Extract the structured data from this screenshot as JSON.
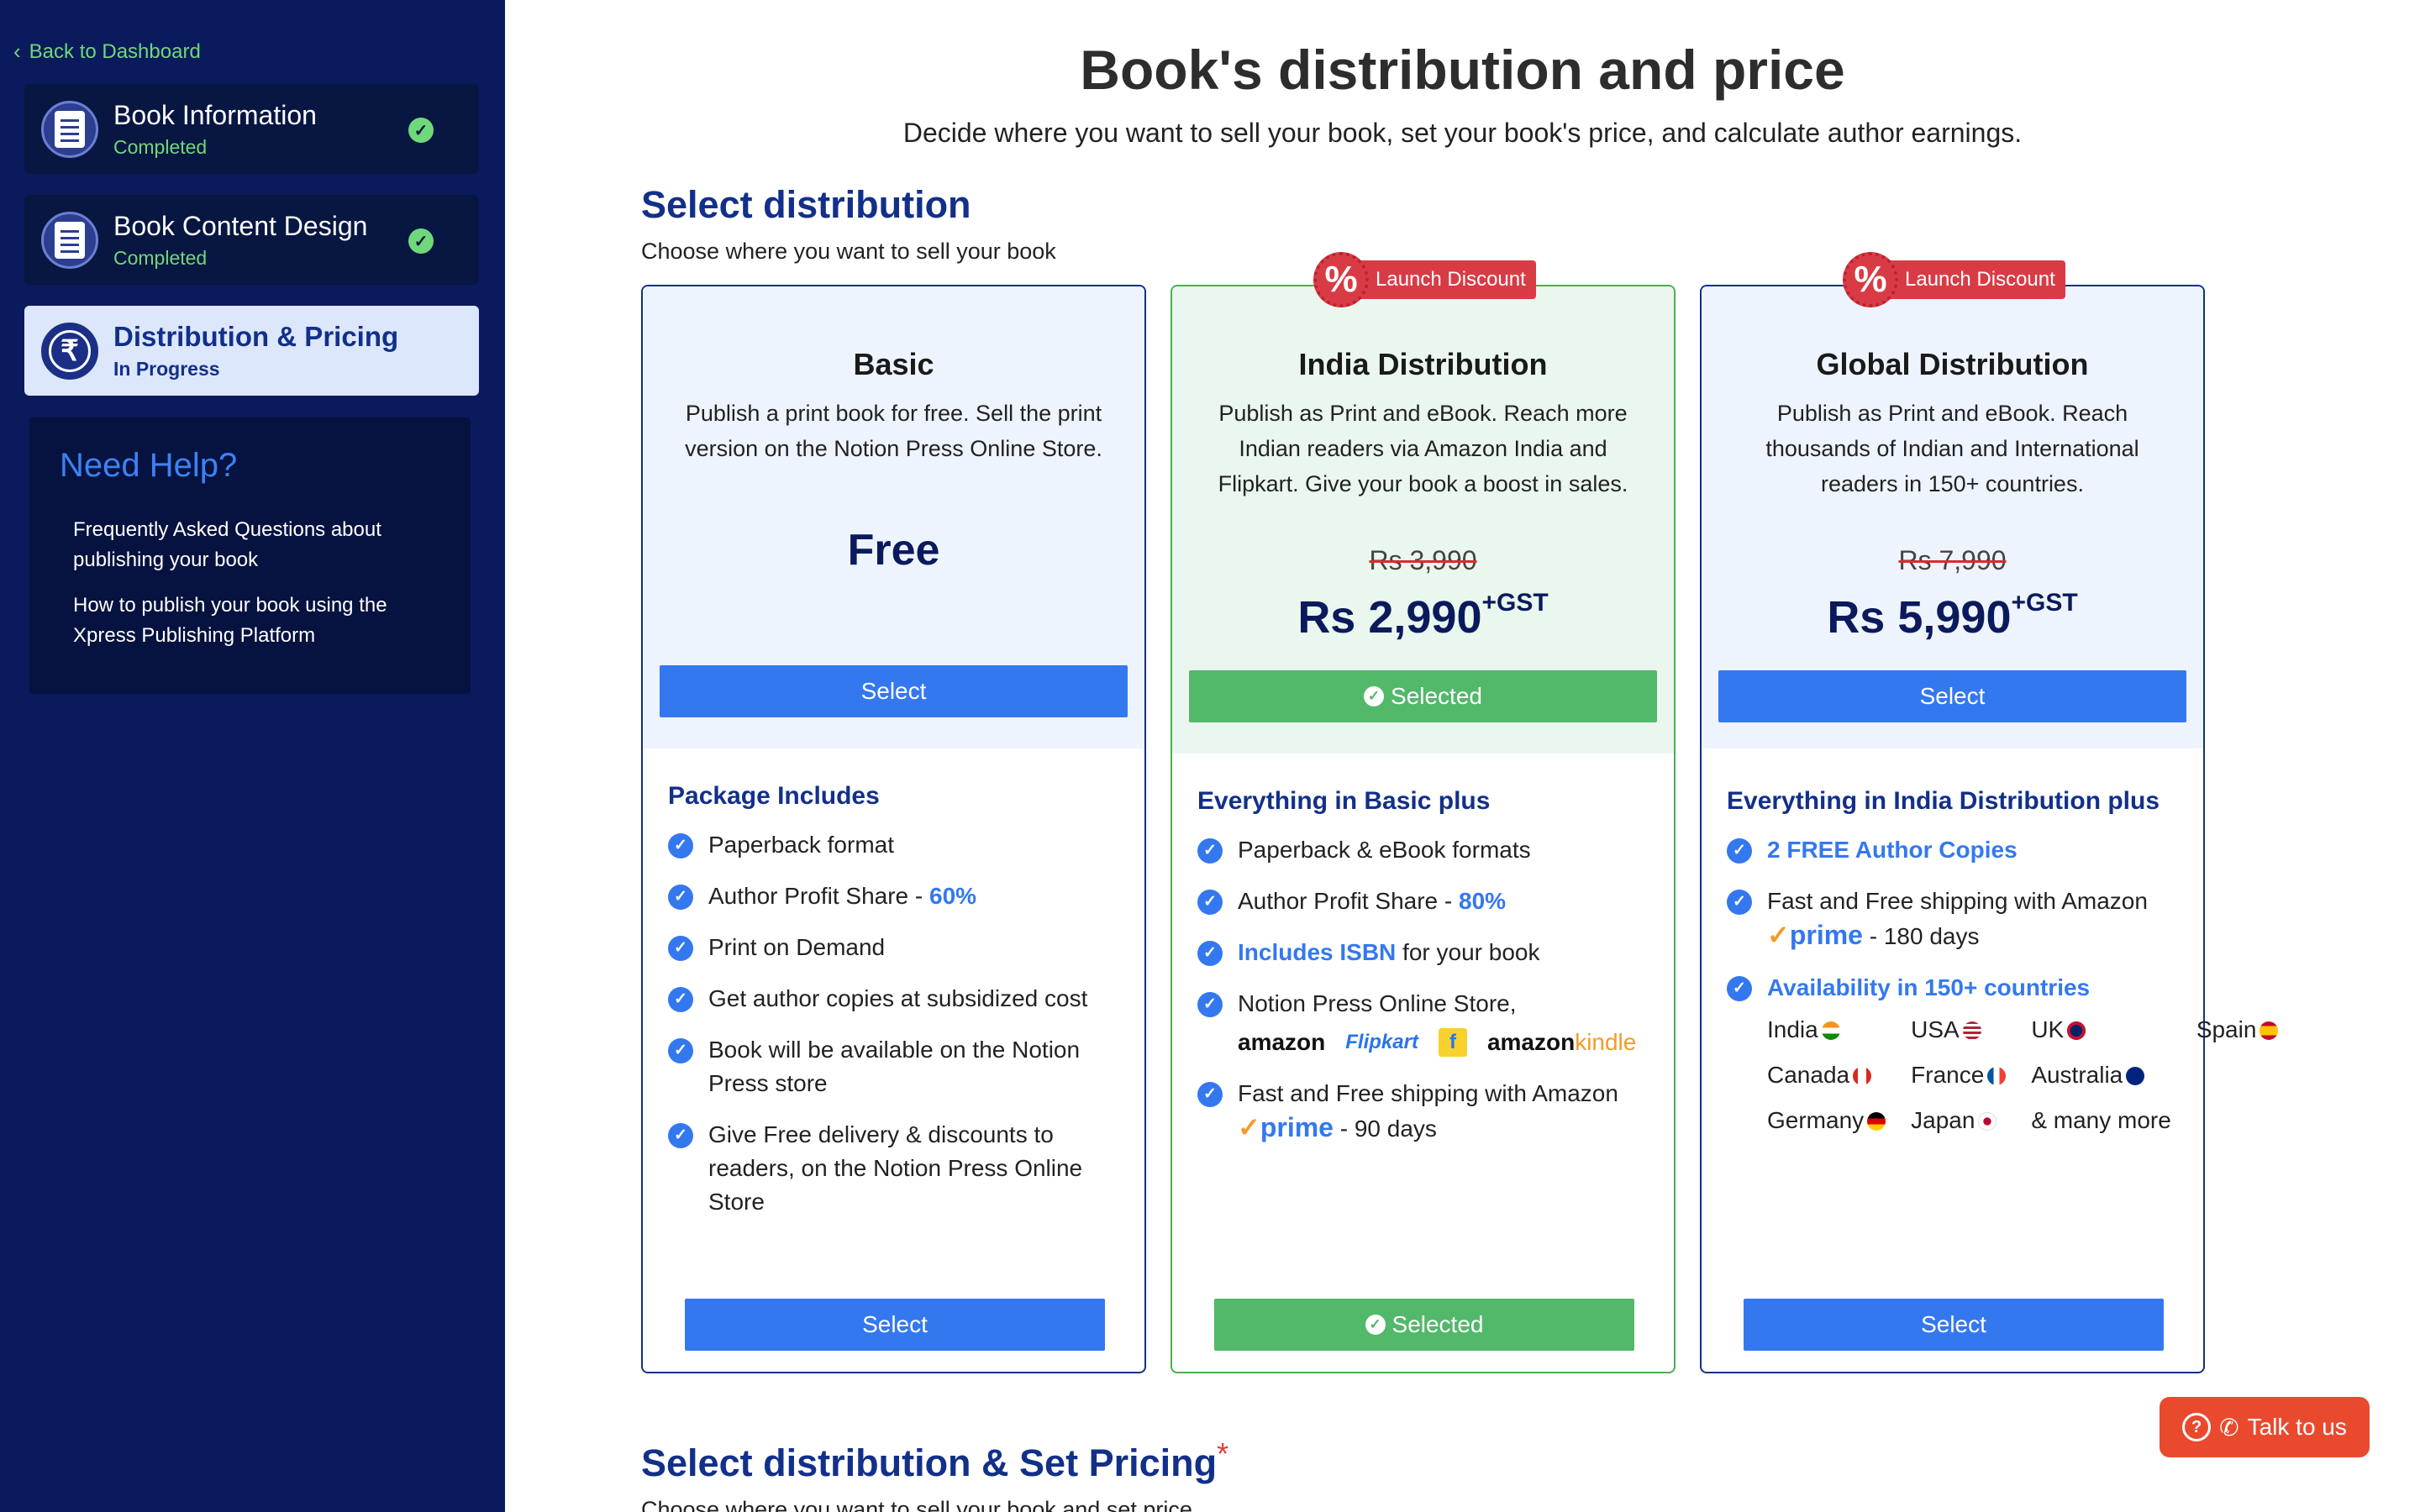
{
  "sidebar": {
    "back_label": "Back to Dashboard",
    "steps": [
      {
        "title": "Book Information",
        "status": "Completed"
      },
      {
        "title": "Book Content Design",
        "status": "Completed"
      },
      {
        "title": "Distribution & Pricing",
        "status": "In Progress"
      }
    ],
    "help": {
      "title": "Need Help?",
      "links": [
        "Frequently Asked Questions about publishing your book",
        "How to publish your book using the Xpress Publishing Platform"
      ]
    }
  },
  "main": {
    "title": "Book's distribution and price",
    "subtitle": "Decide where you want to sell your book, set your book's price, and calculate author earnings.",
    "select_distribution": {
      "title": "Select distribution",
      "subtitle": "Choose where you want to sell your book"
    },
    "plans": [
      {
        "name": "Basic",
        "description": "Publish a print book for free. Sell the print version on the Notion Press Online Store.",
        "price": "Free",
        "button": "Select",
        "includes_title": "Package Includes",
        "features": [
          "Paperback format",
          "Author Profit Share - ",
          "60%",
          "Print on Demand",
          "Get author copies at subsidized cost",
          "Book will be available on the Notion Press store",
          "Give Free delivery & discounts to readers, on the Notion Press Online Store"
        ]
      },
      {
        "name": "India Distribution",
        "badge": "Launch Discount",
        "badge_symbol": "%",
        "description": "Publish as Print and eBook. Reach more Indian readers via Amazon India and Flipkart. Give your book a boost in sales.",
        "old_price": "Rs 3,990",
        "price": "Rs 2,990",
        "tax": "+GST",
        "button": "Selected",
        "includes_title": "Everything in Basic plus",
        "features": {
          "f1": "Paperback & eBook formats",
          "f2a": "Author Profit Share - ",
          "f2b": "80%",
          "f3a": "Includes ISBN",
          "f3b": " for your book",
          "f4": "Notion Press Online Store,",
          "f5a": "Fast and Free shipping with Amazon ",
          "f5b": " - 90 days"
        },
        "logos": {
          "amazon": "amazon",
          "flipkart": "Flipkart",
          "flipkart_icon": "f",
          "amazon2": "amazon",
          "kindle": "kindle"
        }
      },
      {
        "name": "Global Distribution",
        "badge": "Launch Discount",
        "badge_symbol": "%",
        "description": "Publish as Print and eBook. Reach thousands of Indian and International readers in 150+ countries.",
        "old_price": "Rs 7,990",
        "price": "Rs 5,990",
        "tax": "+GST",
        "button": "Select",
        "includes_title": "Everything in India Distribution plus",
        "features": {
          "f1": "2 FREE Author Copies",
          "f2a": "Fast and Free shipping with Amazon ",
          "f2b": " - 180 days",
          "f3": "Availability in 150+ countries"
        },
        "countries": [
          "India",
          "USA",
          "UK",
          "Spain",
          "Canada",
          "France",
          "Australia",
          "Germany",
          "Japan",
          "& many more"
        ]
      }
    ],
    "prime": {
      "tick": "✓",
      "word": "prime"
    },
    "set_pricing": {
      "title": "Select distribution & Set Pricing",
      "required_mark": "*",
      "subtitle": "Choose where you want to sell your book and set price"
    }
  },
  "talk_button": {
    "label": "Talk to us",
    "icon": "phone-icon"
  },
  "colors": {
    "sidebar": "#0a1a5c",
    "primary": "#3478f0",
    "selected": "#52b86a",
    "badge": "#d93b45",
    "talk": "#e94a2e"
  }
}
